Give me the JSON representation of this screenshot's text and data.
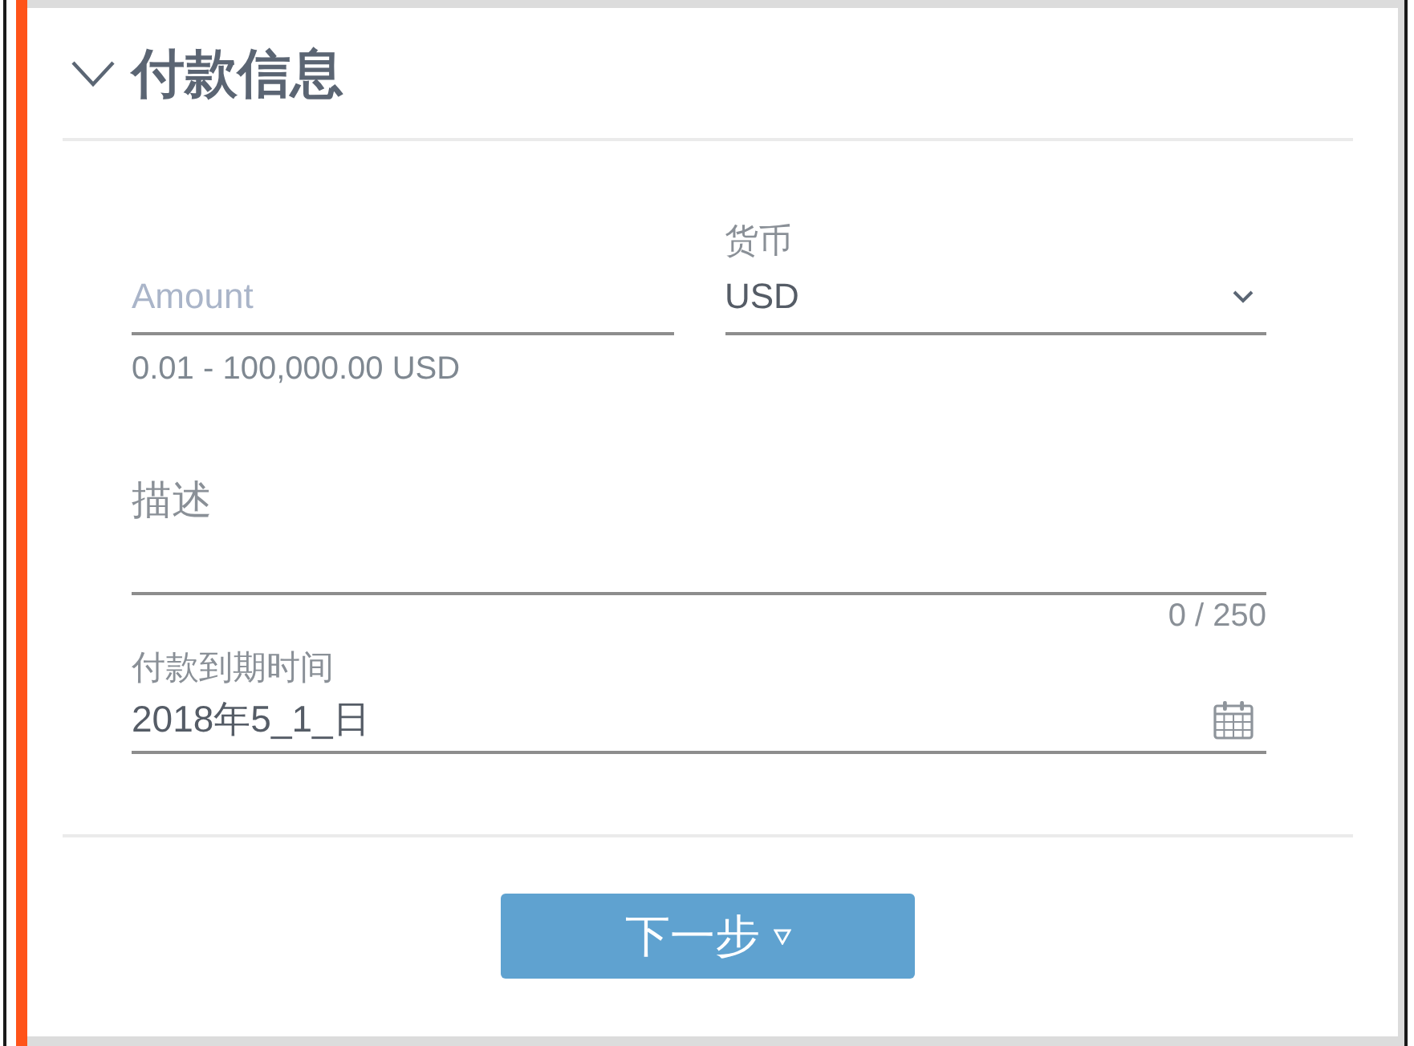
{
  "section": {
    "title": "付款信息",
    "expanded": true
  },
  "amount": {
    "placeholder": "Amount",
    "hint": "0.01 - 100,000.00 USD"
  },
  "currency": {
    "label": "货币",
    "value": "USD"
  },
  "description": {
    "label": "描述",
    "counter": "0 / 250"
  },
  "due_date": {
    "label": "付款到期时间",
    "value": "2018年5_1_日"
  },
  "next_button": {
    "label": "下一步"
  }
}
